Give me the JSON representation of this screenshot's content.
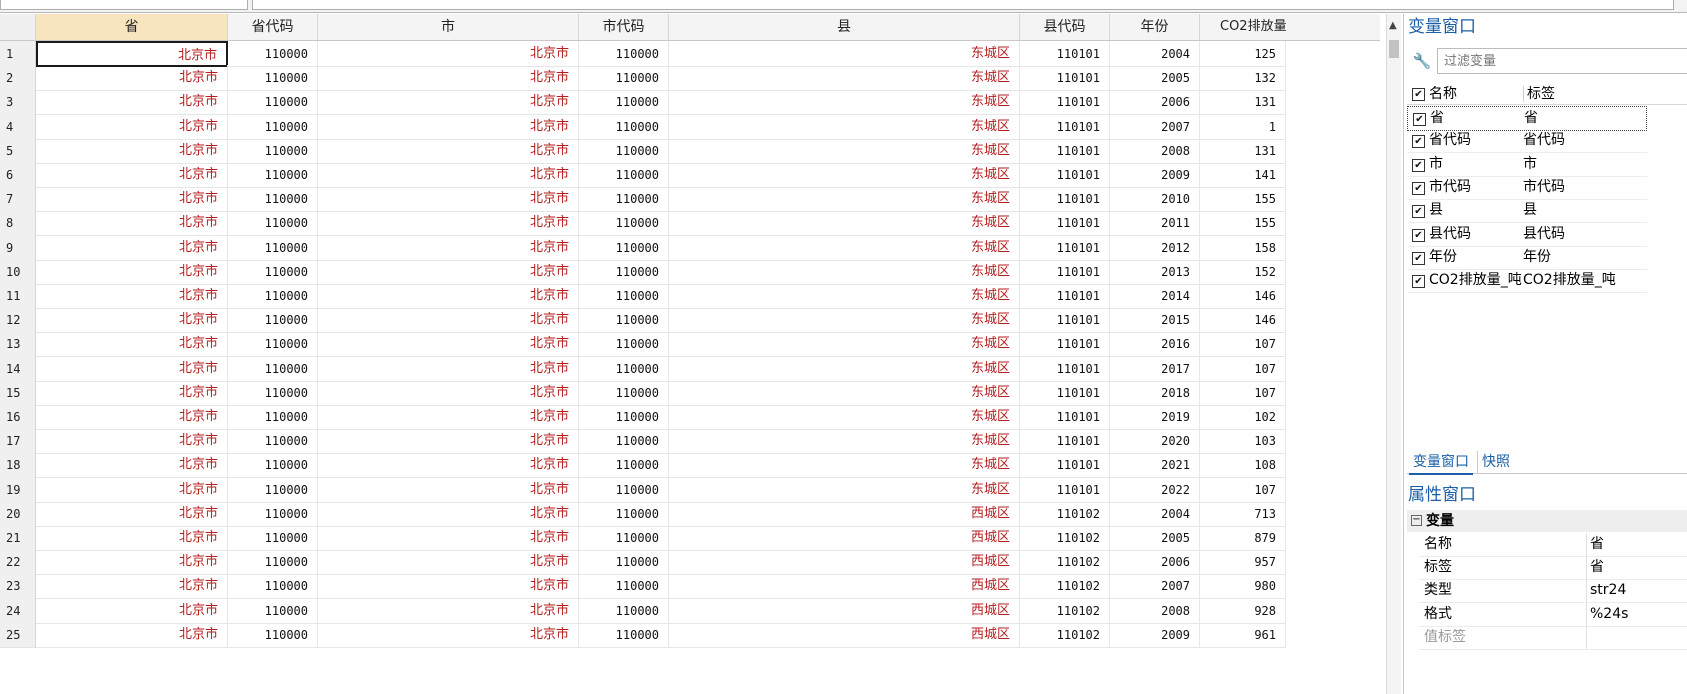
{
  "grid": {
    "columns": [
      "省",
      "省代码",
      "市",
      "市代码",
      "县",
      "县代码",
      "年份",
      "CO2排放量"
    ],
    "rows": [
      [
        "1",
        "北京市",
        "110000",
        "北京市",
        "110000",
        "东城区",
        "110101",
        "2004",
        "125"
      ],
      [
        "2",
        "北京市",
        "110000",
        "北京市",
        "110000",
        "东城区",
        "110101",
        "2005",
        "132"
      ],
      [
        "3",
        "北京市",
        "110000",
        "北京市",
        "110000",
        "东城区",
        "110101",
        "2006",
        "131"
      ],
      [
        "4",
        "北京市",
        "110000",
        "北京市",
        "110000",
        "东城区",
        "110101",
        "2007",
        "1"
      ],
      [
        "5",
        "北京市",
        "110000",
        "北京市",
        "110000",
        "东城区",
        "110101",
        "2008",
        "131"
      ],
      [
        "6",
        "北京市",
        "110000",
        "北京市",
        "110000",
        "东城区",
        "110101",
        "2009",
        "141"
      ],
      [
        "7",
        "北京市",
        "110000",
        "北京市",
        "110000",
        "东城区",
        "110101",
        "2010",
        "155"
      ],
      [
        "8",
        "北京市",
        "110000",
        "北京市",
        "110000",
        "东城区",
        "110101",
        "2011",
        "155"
      ],
      [
        "9",
        "北京市",
        "110000",
        "北京市",
        "110000",
        "东城区",
        "110101",
        "2012",
        "158"
      ],
      [
        "10",
        "北京市",
        "110000",
        "北京市",
        "110000",
        "东城区",
        "110101",
        "2013",
        "152"
      ],
      [
        "11",
        "北京市",
        "110000",
        "北京市",
        "110000",
        "东城区",
        "110101",
        "2014",
        "146"
      ],
      [
        "12",
        "北京市",
        "110000",
        "北京市",
        "110000",
        "东城区",
        "110101",
        "2015",
        "146"
      ],
      [
        "13",
        "北京市",
        "110000",
        "北京市",
        "110000",
        "东城区",
        "110101",
        "2016",
        "107"
      ],
      [
        "14",
        "北京市",
        "110000",
        "北京市",
        "110000",
        "东城区",
        "110101",
        "2017",
        "107"
      ],
      [
        "15",
        "北京市",
        "110000",
        "北京市",
        "110000",
        "东城区",
        "110101",
        "2018",
        "107"
      ],
      [
        "16",
        "北京市",
        "110000",
        "北京市",
        "110000",
        "东城区",
        "110101",
        "2019",
        "102"
      ],
      [
        "17",
        "北京市",
        "110000",
        "北京市",
        "110000",
        "东城区",
        "110101",
        "2020",
        "103"
      ],
      [
        "18",
        "北京市",
        "110000",
        "北京市",
        "110000",
        "东城区",
        "110101",
        "2021",
        "108"
      ],
      [
        "19",
        "北京市",
        "110000",
        "北京市",
        "110000",
        "东城区",
        "110101",
        "2022",
        "107"
      ],
      [
        "20",
        "北京市",
        "110000",
        "北京市",
        "110000",
        "西城区",
        "110102",
        "2004",
        "713"
      ],
      [
        "21",
        "北京市",
        "110000",
        "北京市",
        "110000",
        "西城区",
        "110102",
        "2005",
        "879"
      ],
      [
        "22",
        "北京市",
        "110000",
        "北京市",
        "110000",
        "西城区",
        "110102",
        "2006",
        "957"
      ],
      [
        "23",
        "北京市",
        "110000",
        "北京市",
        "110000",
        "西城区",
        "110102",
        "2007",
        "980"
      ],
      [
        "24",
        "北京市",
        "110000",
        "北京市",
        "110000",
        "西城区",
        "110102",
        "2008",
        "928"
      ],
      [
        "25",
        "北京市",
        "110000",
        "北京市",
        "110000",
        "西城区",
        "110102",
        "2009",
        "961"
      ]
    ]
  },
  "variables_panel": {
    "title": "变量窗口",
    "filter_placeholder": "过滤变量",
    "header_name": "名称",
    "header_label": "标签",
    "items": [
      {
        "name": "省",
        "label": "省"
      },
      {
        "name": "省代码",
        "label": "省代码"
      },
      {
        "name": "市",
        "label": "市"
      },
      {
        "name": "市代码",
        "label": "市代码"
      },
      {
        "name": "县",
        "label": "县"
      },
      {
        "name": "县代码",
        "label": "县代码"
      },
      {
        "name": "年份",
        "label": "年份"
      },
      {
        "name": "CO2排放量_吨",
        "label": "CO2排放量_吨"
      }
    ],
    "tabs": [
      "变量窗口",
      "快照"
    ]
  },
  "properties_panel": {
    "title": "属性窗口",
    "section": "变量",
    "rows": [
      {
        "key": "名称",
        "value": "省"
      },
      {
        "key": "标签",
        "value": "省"
      },
      {
        "key": "类型",
        "value": "str24"
      },
      {
        "key": "格式",
        "value": "%24s"
      },
      {
        "key": "值标签",
        "value": ""
      }
    ]
  },
  "icons": {
    "filter": "wrench-icon",
    "checkbox": "checkbox-checked-icon",
    "collapse": "minus-box-icon",
    "scroll_up": "chevron-up-icon"
  },
  "colors": {
    "string_text": "#b41e1e",
    "accent": "#1c5fa8",
    "selected_header": "#f8e5c0"
  }
}
